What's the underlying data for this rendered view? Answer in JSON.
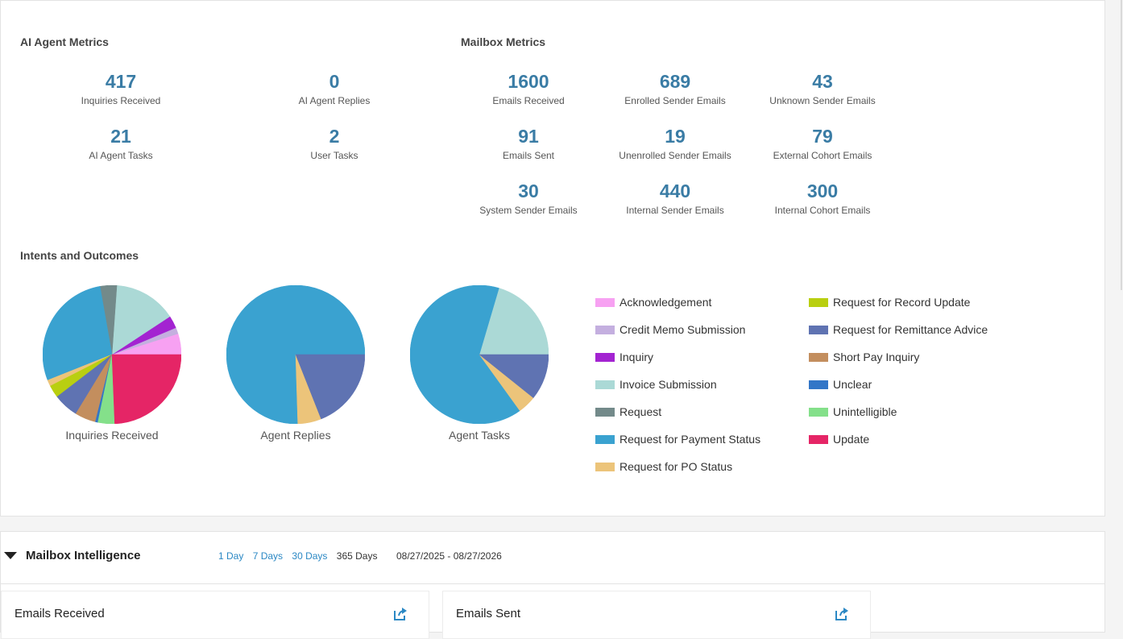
{
  "ai_agent_metrics": {
    "title": "AI Agent Metrics",
    "items": [
      {
        "value": "417",
        "label": "Inquiries Received"
      },
      {
        "value": "0",
        "label": "AI Agent Replies"
      },
      {
        "value": "21",
        "label": "AI Agent Tasks"
      },
      {
        "value": "2",
        "label": "User Tasks"
      }
    ]
  },
  "mailbox_metrics": {
    "title": "Mailbox Metrics",
    "items": [
      {
        "value": "1600",
        "label": "Emails Received"
      },
      {
        "value": "689",
        "label": "Enrolled Sender Emails"
      },
      {
        "value": "43",
        "label": "Unknown Sender Emails"
      },
      {
        "value": "91",
        "label": "Emails Sent"
      },
      {
        "value": "19",
        "label": "Unenrolled Sender Emails"
      },
      {
        "value": "79",
        "label": "External Cohort Emails"
      },
      {
        "value": "30",
        "label": "System Sender Emails"
      },
      {
        "value": "440",
        "label": "Internal Sender Emails"
      },
      {
        "value": "300",
        "label": "Internal Cohort Emails"
      }
    ]
  },
  "intents": {
    "title": "Intents and Outcomes",
    "legend": [
      {
        "label": "Acknowledgement",
        "color": "#f7a1f2"
      },
      {
        "label": "Credit Memo Submission",
        "color": "#c4afdf"
      },
      {
        "label": "Inquiry",
        "color": "#a323d1"
      },
      {
        "label": "Invoice Submission",
        "color": "#abd9d6"
      },
      {
        "label": "Request",
        "color": "#738a8a"
      },
      {
        "label": "Request for Payment Status",
        "color": "#3aa2d0"
      },
      {
        "label": "Request for PO Status",
        "color": "#ecc47a"
      },
      {
        "label": "Request for Record Update",
        "color": "#b9cf10"
      },
      {
        "label": "Request for Remittance Advice",
        "color": "#5f73b2"
      },
      {
        "label": "Short Pay Inquiry",
        "color": "#c38e5e"
      },
      {
        "label": "Unclear",
        "color": "#3376c7"
      },
      {
        "label": "Unintelligible",
        "color": "#84e08a"
      },
      {
        "label": "Update",
        "color": "#e52566"
      }
    ]
  },
  "chart_data": [
    {
      "type": "pie",
      "title": "Inquiries Received",
      "slices": [
        {
          "name": "Acknowledgement",
          "value": 5
        },
        {
          "name": "Credit Memo Submission",
          "value": 1.5
        },
        {
          "name": "Inquiry",
          "value": 3
        },
        {
          "name": "Invoice Submission",
          "value": 15
        },
        {
          "name": "Request",
          "value": 4
        },
        {
          "name": "Request for Payment Status",
          "value": 29
        },
        {
          "name": "Request for PO Status",
          "value": 1.5
        },
        {
          "name": "Request for Record Update",
          "value": 3
        },
        {
          "name": "Request for Remittance Advice",
          "value": 6
        },
        {
          "name": "Short Pay Inquiry",
          "value": 5
        },
        {
          "name": "Unclear",
          "value": 0.6
        },
        {
          "name": "Unintelligible",
          "value": 4
        },
        {
          "name": "Update",
          "value": 25
        }
      ]
    },
    {
      "type": "pie",
      "title": "Agent Replies",
      "slices": [
        {
          "name": "Request for Payment Status",
          "value": 75.5
        },
        {
          "name": "Request for PO Status",
          "value": 5.5
        },
        {
          "name": "Request for Remittance Advice",
          "value": 19
        }
      ]
    },
    {
      "type": "pie",
      "title": "Agent Tasks",
      "slices": [
        {
          "name": "Invoice Submission",
          "value": 19
        },
        {
          "name": "Request for Payment Status",
          "value": 60
        },
        {
          "name": "Request for PO Status",
          "value": 4
        },
        {
          "name": "Request for Remittance Advice",
          "value": 10
        }
      ]
    }
  ],
  "mailbox_intelligence": {
    "title": "Mailbox Intelligence",
    "ranges": [
      "1 Day",
      "7 Days",
      "30 Days",
      "365 Days"
    ],
    "active_range": "365 Days",
    "date_start": "08/27/2025",
    "date_sep": "-",
    "date_end": "08/27/2026"
  },
  "cards": [
    {
      "title": "Emails Received"
    },
    {
      "title": "Emails Sent"
    }
  ]
}
